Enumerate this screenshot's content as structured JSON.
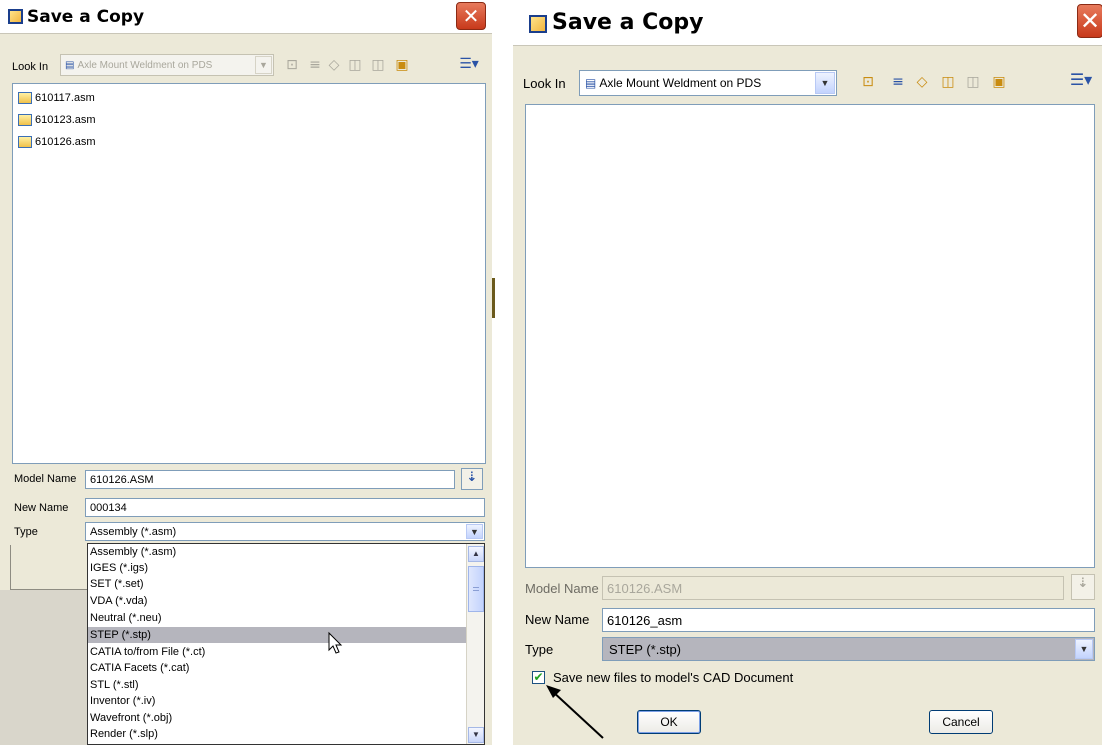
{
  "left": {
    "title": "Save a Copy",
    "close_glyph": "✕",
    "look_in_label": "Look In",
    "look_in_value": "Axle Mount Weldment on PDS",
    "files": [
      "610117.asm",
      "610123.asm",
      "610126.asm"
    ],
    "model_name_label": "Model Name",
    "model_name_value": "610126.ASM",
    "new_name_label": "New Name",
    "new_name_value": "000134",
    "type_label": "Type",
    "type_value": "Assembly (*.asm)",
    "type_options": [
      "Assembly (*.asm)",
      "IGES (*.igs)",
      "SET (*.set)",
      "VDA (*.vda)",
      "Neutral (*.neu)",
      "STEP (*.stp)",
      "CATIA to/from File (*.ct)",
      "CATIA Facets (*.cat)",
      "STL (*.stl)",
      "Inventor (*.iv)",
      "Wavefront (*.obj)",
      "Render (*.slp)"
    ],
    "highlighted_option": "STEP (*.stp)"
  },
  "right": {
    "title": "Save a Copy",
    "close_glyph": "✕",
    "look_in_label": "Look In",
    "look_in_value": "Axle Mount Weldment on PDS",
    "model_name_label": "Model Name",
    "model_name_value": "610126.ASM",
    "new_name_label": "New Name",
    "new_name_value": "610126_asm",
    "type_label": "Type",
    "type_value": "STEP (*.stp)",
    "checkbox_label": "Save new files to model's CAD Document",
    "checkbox_checked": "✔",
    "ok_label": "OK",
    "cancel_label": "Cancel"
  },
  "icons": {
    "lookin": "folder-tree-icon",
    "up": "up-folder-icon",
    "list": "view-list-icon",
    "select": "model-select-icon",
    "arrow": "chevron-down-icon"
  },
  "colors": {
    "dialog_bg": "#ece9d8",
    "field_border": "#7f9db9",
    "close_red": "#c8391b",
    "highlight": "#b5b5bd"
  }
}
